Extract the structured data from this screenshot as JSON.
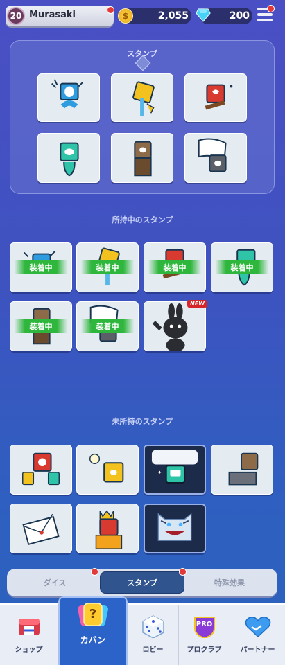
{
  "header": {
    "player": {
      "level": "20",
      "name": "Murasaki"
    },
    "coins": "2,055",
    "gems": "200"
  },
  "equipped_panel": {
    "title": "スタンプ"
  },
  "sections": {
    "owned_title": "所持中のスタンプ",
    "unowned_title": "未所持のスタンプ"
  },
  "owned": {
    "equipped_label": "装着中",
    "new_label": "NEW"
  },
  "tabs": [
    {
      "label": "ダイス"
    },
    {
      "label": "スタンプ"
    },
    {
      "label": "特殊効果"
    }
  ],
  "nav": [
    {
      "label": "ショップ",
      "icon": "shop-icon"
    },
    {
      "label": "カバン",
      "icon": "bag-icon"
    },
    {
      "label": "ロビー",
      "icon": "dice-icon"
    },
    {
      "label": "プロクラブ",
      "icon": "pro-club-icon"
    },
    {
      "label": "パートナー",
      "icon": "partner-icon"
    }
  ],
  "pro_badge": "PRO",
  "bag_icon_glyph": "?",
  "coin_glyph": "$",
  "colors": {
    "accent": "#2c63c9",
    "badge_green": "#2fb63c",
    "new_red": "#d7262a"
  }
}
